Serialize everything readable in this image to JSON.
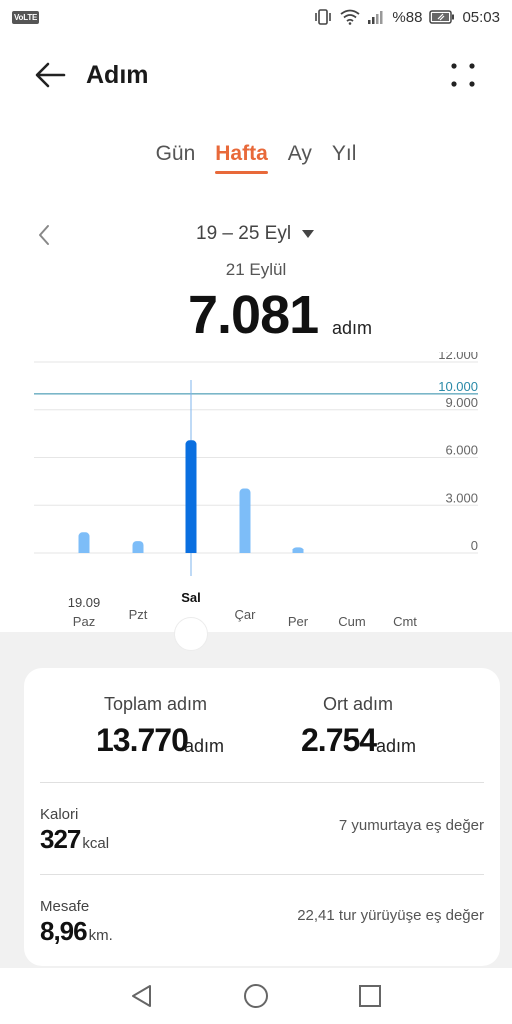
{
  "status_bar": {
    "volte": "VoLTE",
    "battery_percent": "%88",
    "time": "05:03",
    "icons": [
      "vibrate-icon",
      "wifi-icon",
      "signal-icon",
      "battery-icon"
    ]
  },
  "app_bar": {
    "title": "Adım",
    "back_icon": "arrow-left-icon",
    "more_icon": "more-dots-icon"
  },
  "tabs": [
    {
      "label": "Gün",
      "active": false
    },
    {
      "label": "Hafta",
      "active": true
    },
    {
      "label": "Ay",
      "active": false
    },
    {
      "label": "Yıl",
      "active": false
    }
  ],
  "range": {
    "label": "19 – 25 Eyl"
  },
  "selected": {
    "date": "21 Eylül",
    "value": "7.081",
    "unit": "adım"
  },
  "chart_data": {
    "type": "bar",
    "categories": [
      "Paz",
      "Pzt",
      "Sal",
      "Çar",
      "Per",
      "Cum",
      "Cmt"
    ],
    "first_date_label": "19.09",
    "values": [
      1300,
      750,
      7081,
      4050,
      350,
      0,
      0
    ],
    "selected_index": 2,
    "goal": {
      "value": 10000,
      "label": "10.000",
      "color": "#2a8aa8"
    },
    "yticks": [
      {
        "value": 12000,
        "label": "12.000"
      },
      {
        "value": 9000,
        "label": "9.000"
      },
      {
        "value": 6000,
        "label": "6.000"
      },
      {
        "value": 3000,
        "label": "3.000"
      },
      {
        "value": 0,
        "label": "0"
      }
    ],
    "ylim": [
      0,
      12000
    ],
    "colors": {
      "bar": "#7dbdf8",
      "bar_selected": "#0a6fe0",
      "grid": "#e6e6e6"
    }
  },
  "summary": {
    "total_label": "Toplam adım",
    "total_value": "13.770",
    "total_unit": "adım",
    "avg_label": "Ort adım",
    "avg_value": "2.754",
    "avg_unit": "adım"
  },
  "calorie": {
    "label": "Kalori",
    "value": "327",
    "unit": "kcal",
    "equivalent": "7 yumurtaya eş değer"
  },
  "distance": {
    "label": "Mesafe",
    "value": "8,96",
    "unit": "km.",
    "equivalent": "22,41 tur yürüyüşe eş değer"
  },
  "nav": {
    "icons": [
      "back-triangle-icon",
      "home-circle-icon",
      "recents-square-icon"
    ]
  },
  "colors": {
    "accent": "#e8693a",
    "bar": "#7dbdf8",
    "bar_selected": "#0a6fe0"
  }
}
